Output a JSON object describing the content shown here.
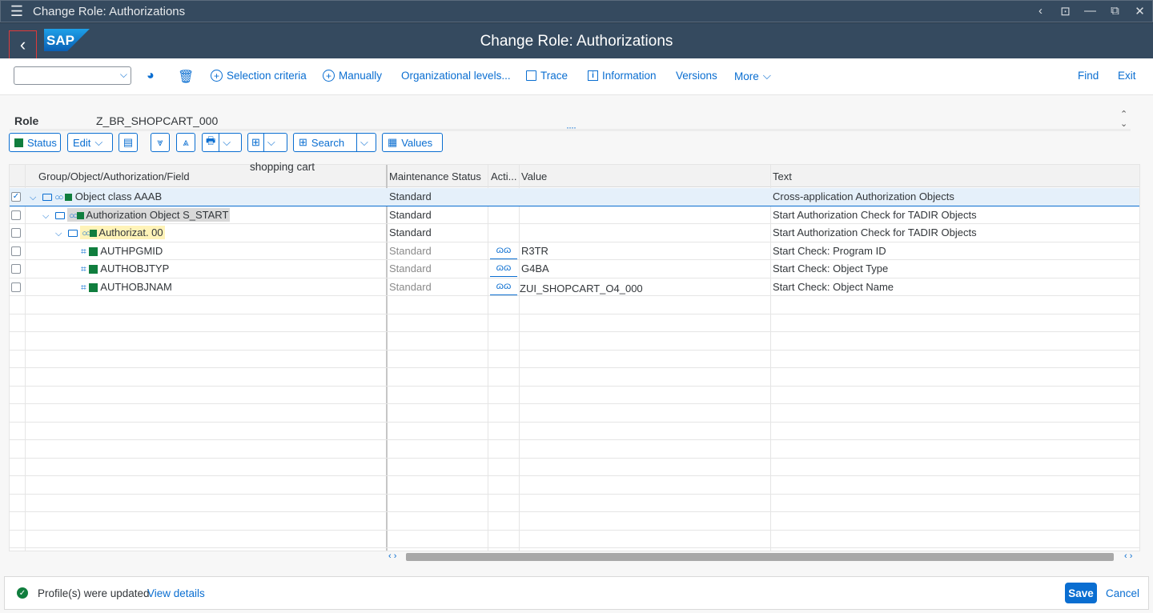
{
  "window": {
    "title": "Change Role: Authorizations",
    "controls": [
      "‹",
      "⊡",
      "—",
      "⧉",
      "✕"
    ]
  },
  "shell": {
    "app_title": "Change Role: Authorizations",
    "logo_text": "SAP"
  },
  "toolbar": {
    "combo_value": "",
    "selection_criteria": "Selection criteria",
    "manually": "Manually",
    "org_levels": "Organizational levels...",
    "trace": "Trace",
    "information": "Information",
    "versions": "Versions",
    "more": "More",
    "find": "Find",
    "exit": "Exit"
  },
  "role": {
    "label": "Role",
    "value": "Z_BR_SHOPCART_000",
    "tooltip": "shopping cart"
  },
  "alv_toolbar": {
    "status": "Status",
    "edit": "Edit",
    "search": "Search",
    "values": "Values"
  },
  "grid": {
    "columns": [
      "Group/Object/Authorization/Field",
      "Maintenance Status",
      "Acti...",
      "Value",
      "Text"
    ],
    "rows": [
      {
        "label": "Object class AAAB",
        "status": "Standard",
        "value": "",
        "text": "Cross-application Authorization Objects",
        "checked": true
      },
      {
        "label": "Authorization Object S_START",
        "status": "Standard",
        "value": "",
        "text": "Start Authorization Check for TADIR Objects",
        "checked": false
      },
      {
        "label": "Authorizat. 00",
        "status": "Standard",
        "value": "",
        "text": "Start Authorization Check for TADIR Objects",
        "checked": false
      },
      {
        "label": "AUTHPGMID",
        "status": "Standard",
        "value": "R3TR",
        "text": "Start Check: Program ID",
        "checked": false
      },
      {
        "label": "AUTHOBJTYP",
        "status": "Standard",
        "value": "G4BA",
        "text": "Start Check: Object Type",
        "checked": false
      },
      {
        "label": "AUTHOBJNAM",
        "status": "Standard",
        "value": "ZUI_SHOPCART_O4_000",
        "text": "Start Check: Object Name",
        "checked": false
      }
    ]
  },
  "footer": {
    "message": "Profile(s) were updated",
    "view_details": "View details",
    "save": "Save",
    "cancel": "Cancel"
  },
  "colors": {
    "shell": "#354a5f",
    "accent": "#0a6ed1",
    "positive": "#107e3e"
  }
}
